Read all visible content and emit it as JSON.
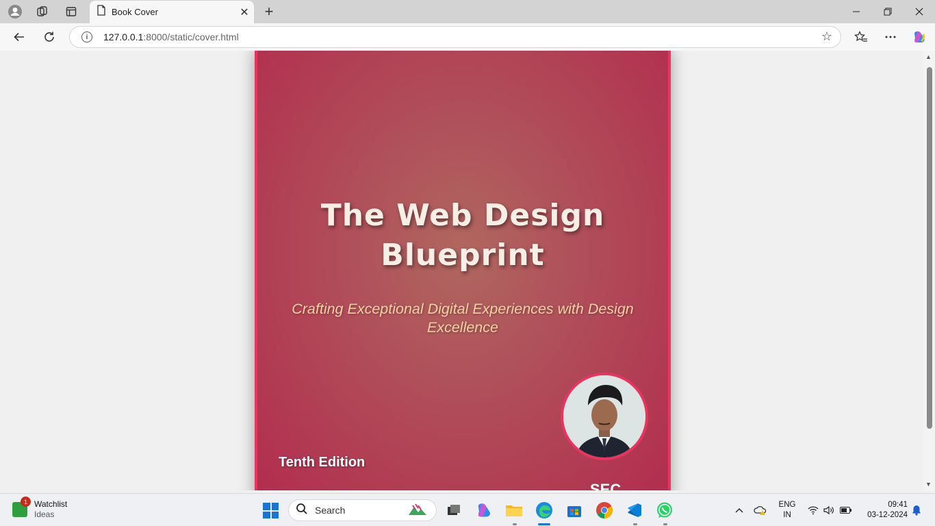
{
  "browser": {
    "tab_title": "Book Cover",
    "url_host": "127.0.0.1",
    "url_rest": ":8000/static/cover.html"
  },
  "cover": {
    "title_line1": "The Web Design",
    "title_line2": "Blueprint",
    "subtitle_line1": "Crafting Exceptional Digital Experiences with Design",
    "subtitle_line2": "Excellence",
    "edition": "Tenth Edition",
    "partial_text": "SEC",
    "accent_color": "#e8345f",
    "background_color": "#b22c4e"
  },
  "taskbar": {
    "widget_title": "Watchlist",
    "widget_sub": "Ideas",
    "widget_badge": "1",
    "search_label": "Search",
    "lang_line1": "ENG",
    "lang_line2": "IN",
    "time": "09:41",
    "date": "03-12-2024"
  }
}
